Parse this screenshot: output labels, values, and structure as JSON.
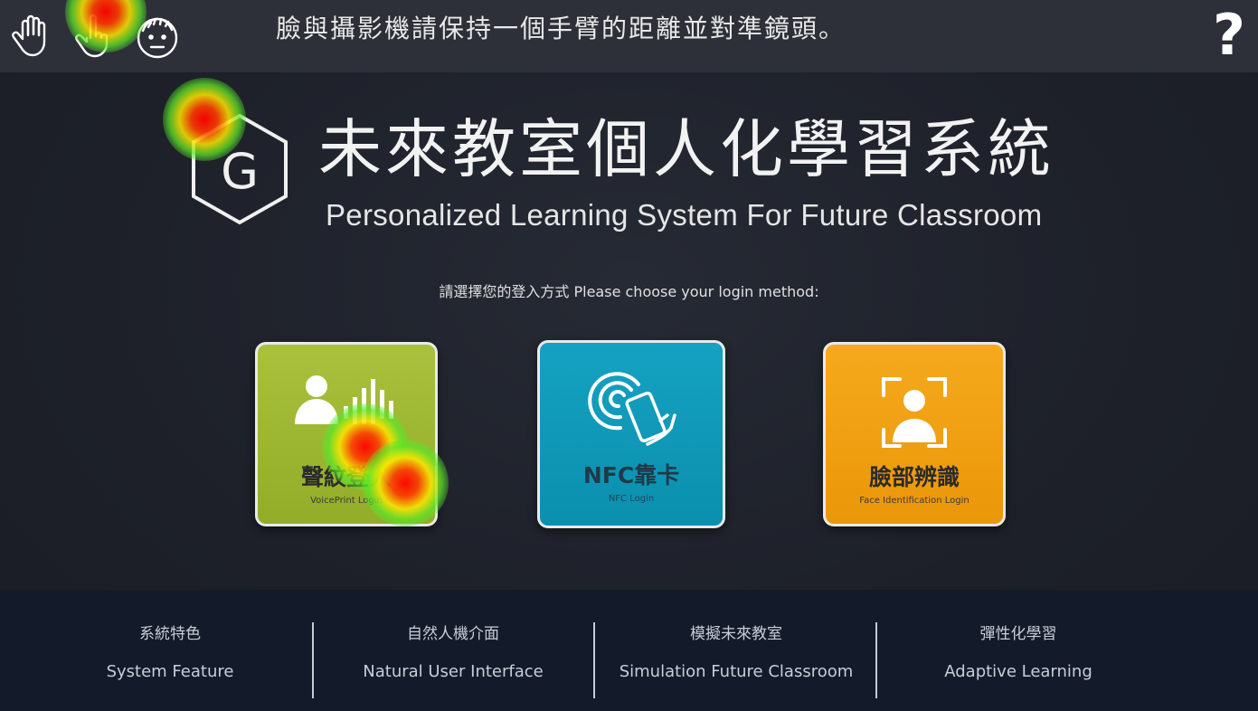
{
  "topbar": {
    "gestures": [
      "hand-icon",
      "pointing-hand-icon",
      "face-icon"
    ],
    "message": "臉與攝影機請保持一個手臂的距離並對準鏡頭。",
    "help_label": "?"
  },
  "header": {
    "logo_letter": "G",
    "title_cn": "未來教室個人化學習系統",
    "title_en": "Personalized Learning System For Future Classroom"
  },
  "login": {
    "prompt": "請選擇您的登入方式 Please choose your login method:",
    "options": [
      {
        "label": "聲紋登入",
        "sublabel": "VoicePrint Login",
        "icon": "voiceprint-icon",
        "color": "#9db632"
      },
      {
        "label": "NFC靠卡",
        "sublabel": "NFC Login",
        "icon": "nfc-card-icon",
        "color": "#1199b8"
      },
      {
        "label": "臉部辨識",
        "sublabel": "Face Identification Login",
        "icon": "face-scan-icon",
        "color": "#f0a012"
      }
    ]
  },
  "footer": {
    "features": [
      {
        "cn": "系統特色",
        "en": "System Feature"
      },
      {
        "cn": "自然人機介面",
        "en": "Natural User Interface"
      },
      {
        "cn": "模擬未來教室",
        "en": "Simulation Future Classroom"
      },
      {
        "cn": "彈性化學習",
        "en": "Adaptive Learning"
      }
    ]
  }
}
